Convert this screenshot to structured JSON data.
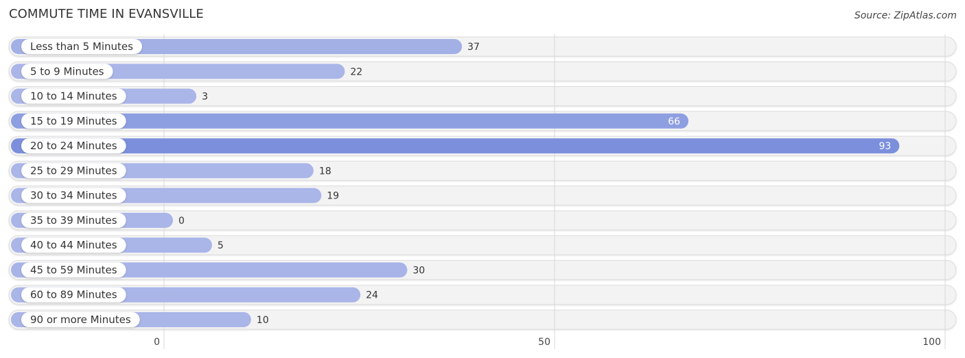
{
  "chart_data": {
    "type": "bar",
    "orientation": "horizontal",
    "title": "COMMUTE TIME IN EVANSVILLE",
    "source": "Source: ZipAtlas.com",
    "categories": [
      "Less than 5 Minutes",
      "5 to 9 Minutes",
      "10 to 14 Minutes",
      "15 to 19 Minutes",
      "20 to 24 Minutes",
      "25 to 29 Minutes",
      "30 to 34 Minutes",
      "35 to 39 Minutes",
      "40 to 44 Minutes",
      "45 to 59 Minutes",
      "60 to 89 Minutes",
      "90 or more Minutes"
    ],
    "values": [
      37,
      22,
      3,
      66,
      93,
      18,
      19,
      0,
      5,
      30,
      24,
      10
    ],
    "value_labels": [
      "37",
      "22",
      "3",
      "66",
      "93",
      "18",
      "19",
      "0",
      "5",
      "30",
      "24",
      "10"
    ],
    "xlabel": "",
    "ylabel": "",
    "xlim": [
      0,
      100
    ],
    "x_ticks": [
      0,
      50,
      100
    ],
    "x_tick_labels": [
      "0",
      "50",
      "100"
    ],
    "grid": true,
    "legend": "none",
    "colors": {
      "bar_light": "#aab5e8",
      "bar_dark": "#7b8fdc",
      "track": "#f3f3f3",
      "track_border": "#dddddd",
      "label_pill": "#ffffff",
      "text": "#333333",
      "value_inside_text": "#ffffff"
    }
  }
}
